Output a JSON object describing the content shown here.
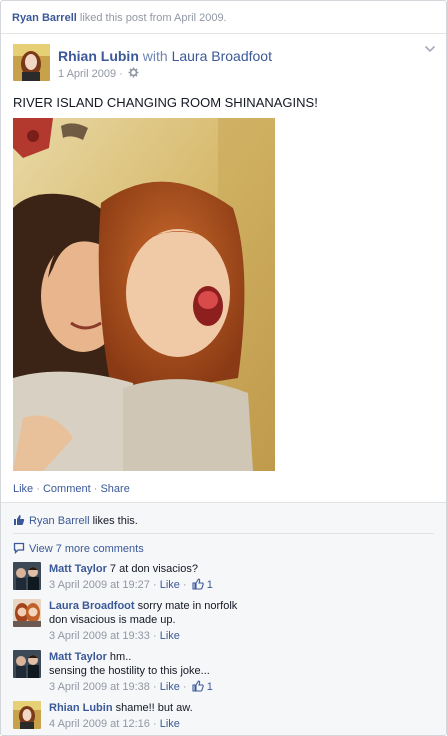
{
  "story_header": {
    "actor": "Ryan Barrell",
    "text": "liked this post from April 2009."
  },
  "post": {
    "author": "Rhian Lubin",
    "with_word": "with",
    "tagged": "Laura Broadfoot",
    "date": "1 April 2009",
    "dot": "·",
    "message": "RIVER ISLAND CHANGING ROOM SHINANAGINS!",
    "actions": [
      "Like",
      "Comment",
      "Share"
    ]
  },
  "ufi": {
    "liker": "Ryan Barrell",
    "likes_text": "likes this.",
    "view_more": "View 7 more comments"
  },
  "comments": [
    {
      "name": "Matt Taylor",
      "text": "7 at don visacios?",
      "text2": "",
      "time": "3 April 2009 at 19:27",
      "like": "Like",
      "likes": "1"
    },
    {
      "name": "Laura Broadfoot",
      "text": "sorry mate in norfolk",
      "text2": "don visacious is made up.",
      "time": "3 April 2009 at 19:33",
      "like": "Like",
      "likes": ""
    },
    {
      "name": "Matt Taylor",
      "text": "hm..",
      "text2": "sensing the hostility to this joke...",
      "time": "3 April 2009 at 19:38",
      "like": "Like",
      "likes": "1"
    },
    {
      "name": "Rhian Lubin",
      "text": "shame!! but aw.",
      "text2": "",
      "time": "4 April 2009 at 12:16",
      "like": "Like",
      "likes": ""
    }
  ],
  "colors": {
    "link": "#3b5998",
    "meta": "#9197a3",
    "ufi_bg": "#f6f7f9"
  }
}
